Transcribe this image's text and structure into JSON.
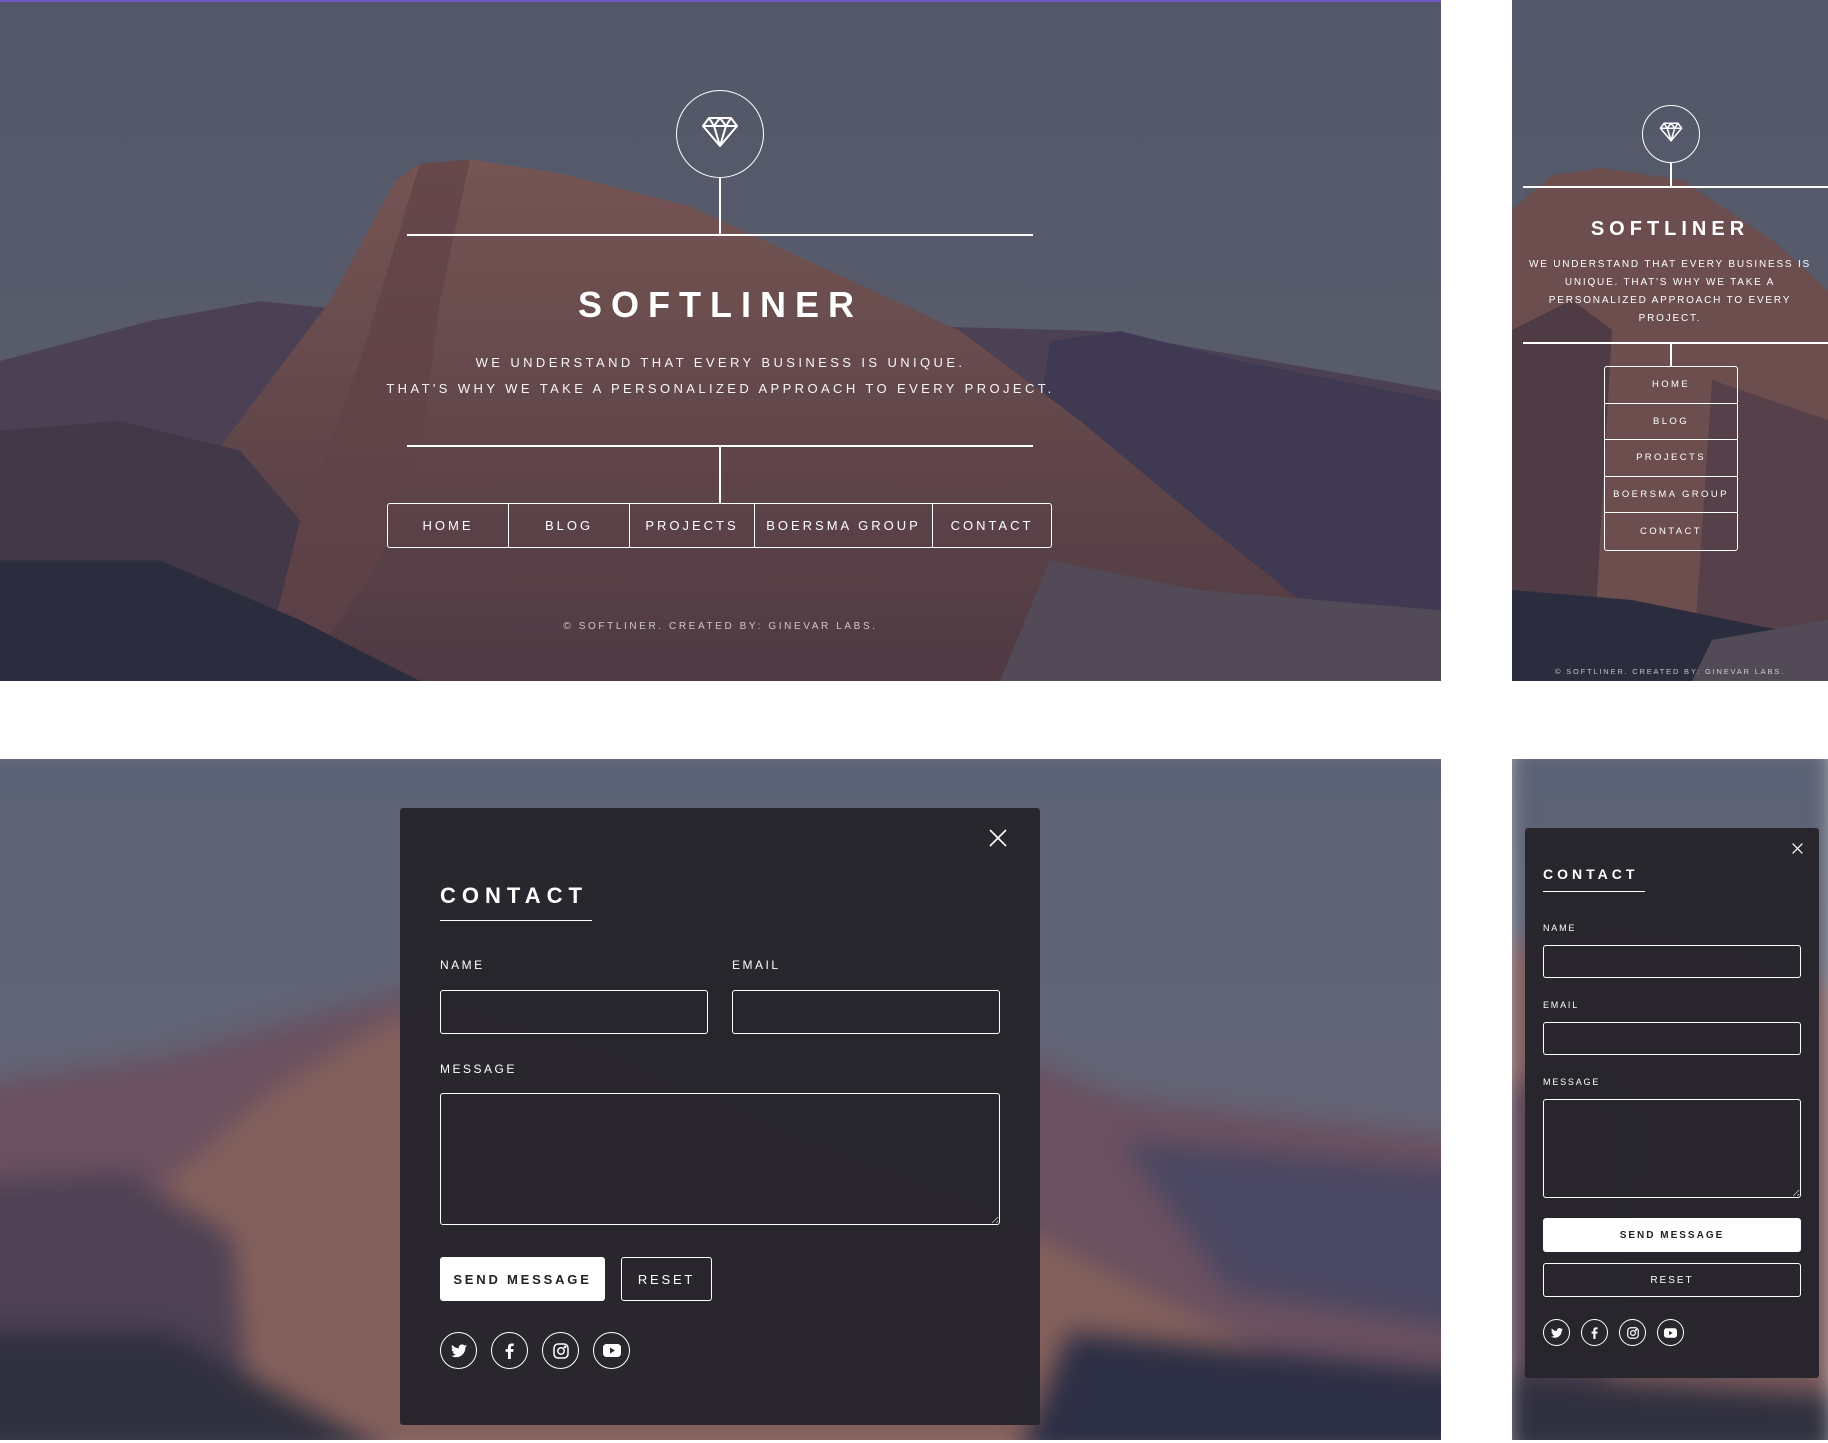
{
  "site": {
    "title": "SOFTLINER",
    "tagline_line1": "WE UNDERSTAND THAT EVERY BUSINESS IS UNIQUE.",
    "tagline_line2": "THAT'S WHY WE TAKE A PERSONALIZED APPROACH TO EVERY PROJECT.",
    "tagline_mobile": "WE UNDERSTAND THAT EVERY BUSINESS IS UNIQUE. THAT'S WHY WE TAKE A PERSONALIZED APPROACH TO EVERY PROJECT.",
    "copyright": "© SOFTLINER. CREATED BY: GINEVAR LABS."
  },
  "nav": {
    "items": [
      {
        "label": "HOME"
      },
      {
        "label": "BLOG"
      },
      {
        "label": "PROJECTS"
      },
      {
        "label": "BOERSMA GROUP"
      },
      {
        "label": "CONTACT"
      }
    ]
  },
  "contact": {
    "title": "CONTACT",
    "name_label": "NAME",
    "email_label": "EMAIL",
    "message_label": "MESSAGE",
    "name_value": "",
    "email_value": "",
    "message_value": "",
    "send_label": "SEND MESSAGE",
    "reset_label": "RESET",
    "social": [
      "twitter-icon",
      "facebook-icon",
      "instagram-icon",
      "youtube-icon"
    ]
  },
  "icons": {
    "logo": "diamond-icon",
    "close": "close-icon"
  },
  "colors": {
    "accent_top_border": "#6f59c9",
    "modal_bg": "#26252b",
    "text": "#ffffff"
  }
}
